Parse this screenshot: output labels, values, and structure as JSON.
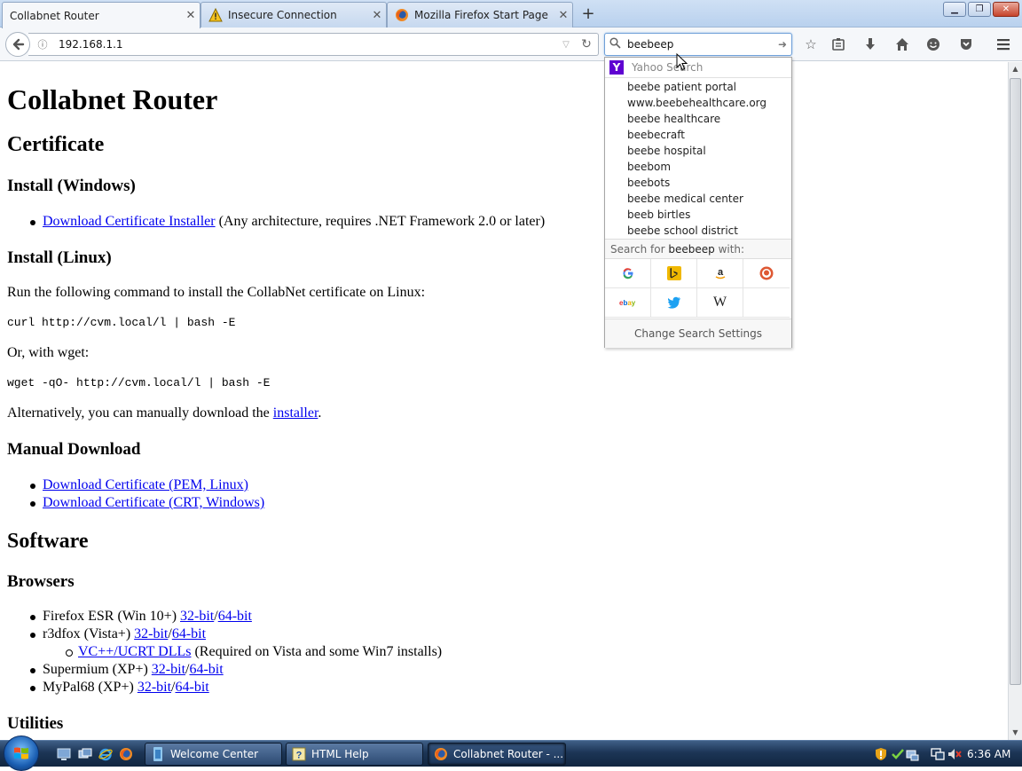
{
  "browser": {
    "tabs": [
      {
        "title": "Collabnet Router",
        "active": true
      },
      {
        "title": "Insecure Connection",
        "active": false
      },
      {
        "title": "Mozilla Firefox Start Page",
        "active": false
      }
    ],
    "url": "192.168.1.1",
    "search_query": "beebeep"
  },
  "search_popup": {
    "engine": "Yahoo Search",
    "suggestions": [
      "beebe patient portal",
      "www.beebehealthcare.org",
      "beebe healthcare",
      "beebecraft",
      "beebe hospital",
      "beebom",
      "beebots",
      "beebe medical center",
      "beeb birtles",
      "beebe school district"
    ],
    "search_for_prefix": "Search for ",
    "search_for_query": "beebeep",
    "search_for_suffix": " with:",
    "engines": [
      "google",
      "bing",
      "amazon",
      "duckduckgo",
      "ebay",
      "twitter",
      "wikipedia"
    ],
    "settings_label": "Change Search Settings"
  },
  "page": {
    "title": "Collabnet Router",
    "certificate_heading": "Certificate",
    "install_windows_heading": "Install (Windows)",
    "installer_link": "Download Certificate Installer",
    "installer_note": " (Any architecture, requires .NET Framework 2.0 or later)",
    "install_linux_heading": "Install (Linux)",
    "linux_intro": "Run the following command to install the CollabNet certificate on Linux:",
    "curl_cmd": "curl http://cvm.local/l | bash -E",
    "wget_intro": "Or, with wget:",
    "wget_cmd": "wget -qO- http://cvm.local/l | bash -E",
    "manual_prefix": "Alternatively, you can manually download the ",
    "manual_link": "installer",
    "manual_suffix": ".",
    "manual_heading": "Manual Download",
    "manual_links": [
      "Download Certificate (PEM, Linux)",
      "Download Certificate (CRT, Windows)"
    ],
    "software_heading": "Software",
    "browsers_heading": "Browsers",
    "browsers": [
      {
        "name": "Firefox ESR (Win 10+) ",
        "link32": "32-bit",
        "link64": "64-bit"
      },
      {
        "name": "r3dfox (Vista+) ",
        "link32": "32-bit",
        "link64": "64-bit"
      },
      {
        "name": "Supermium (XP+) ",
        "link32": "32-bit",
        "link64": "64-bit"
      },
      {
        "name": "MyPal68 (XP+) ",
        "link32": "32-bit",
        "link64": "64-bit"
      }
    ],
    "vc_link": "VC++/UCRT DLLs",
    "vc_note": " (Required on Vista and some Win7 installs)",
    "utilities_heading": "Utilities"
  },
  "taskbar": {
    "tasks": [
      "Welcome Center",
      "HTML Help",
      "Collabnet Router - ..."
    ],
    "clock": "6:36 AM"
  },
  "colors": {
    "link": "#0000ee",
    "yahoo": "#5f01d1",
    "taskbar": "#1c3556"
  }
}
